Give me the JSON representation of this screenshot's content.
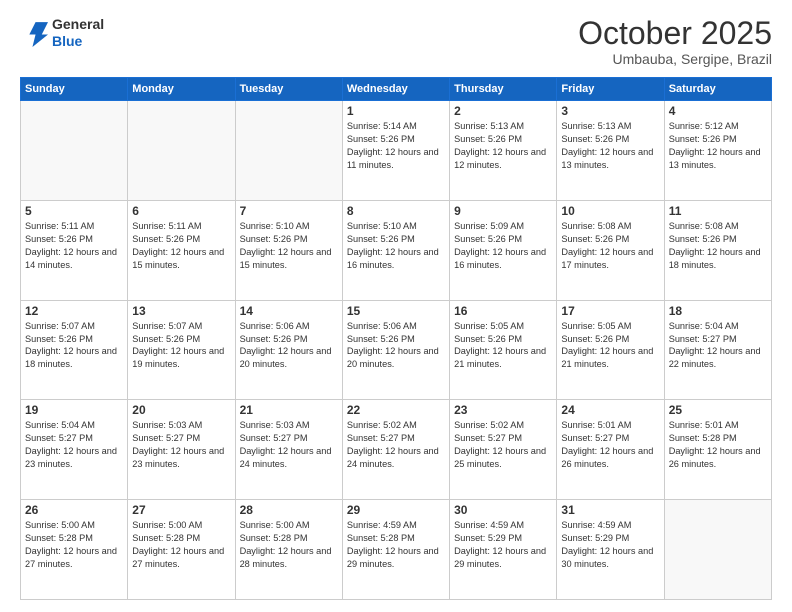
{
  "header": {
    "logo_line1": "General",
    "logo_line2": "Blue",
    "month_title": "October 2025",
    "location": "Umbauba, Sergipe, Brazil"
  },
  "weekdays": [
    "Sunday",
    "Monday",
    "Tuesday",
    "Wednesday",
    "Thursday",
    "Friday",
    "Saturday"
  ],
  "weeks": [
    [
      {
        "day": "",
        "text": ""
      },
      {
        "day": "",
        "text": ""
      },
      {
        "day": "",
        "text": ""
      },
      {
        "day": "1",
        "text": "Sunrise: 5:14 AM\nSunset: 5:26 PM\nDaylight: 12 hours\nand 11 minutes."
      },
      {
        "day": "2",
        "text": "Sunrise: 5:13 AM\nSunset: 5:26 PM\nDaylight: 12 hours\nand 12 minutes."
      },
      {
        "day": "3",
        "text": "Sunrise: 5:13 AM\nSunset: 5:26 PM\nDaylight: 12 hours\nand 13 minutes."
      },
      {
        "day": "4",
        "text": "Sunrise: 5:12 AM\nSunset: 5:26 PM\nDaylight: 12 hours\nand 13 minutes."
      }
    ],
    [
      {
        "day": "5",
        "text": "Sunrise: 5:11 AM\nSunset: 5:26 PM\nDaylight: 12 hours\nand 14 minutes."
      },
      {
        "day": "6",
        "text": "Sunrise: 5:11 AM\nSunset: 5:26 PM\nDaylight: 12 hours\nand 15 minutes."
      },
      {
        "day": "7",
        "text": "Sunrise: 5:10 AM\nSunset: 5:26 PM\nDaylight: 12 hours\nand 15 minutes."
      },
      {
        "day": "8",
        "text": "Sunrise: 5:10 AM\nSunset: 5:26 PM\nDaylight: 12 hours\nand 16 minutes."
      },
      {
        "day": "9",
        "text": "Sunrise: 5:09 AM\nSunset: 5:26 PM\nDaylight: 12 hours\nand 16 minutes."
      },
      {
        "day": "10",
        "text": "Sunrise: 5:08 AM\nSunset: 5:26 PM\nDaylight: 12 hours\nand 17 minutes."
      },
      {
        "day": "11",
        "text": "Sunrise: 5:08 AM\nSunset: 5:26 PM\nDaylight: 12 hours\nand 18 minutes."
      }
    ],
    [
      {
        "day": "12",
        "text": "Sunrise: 5:07 AM\nSunset: 5:26 PM\nDaylight: 12 hours\nand 18 minutes."
      },
      {
        "day": "13",
        "text": "Sunrise: 5:07 AM\nSunset: 5:26 PM\nDaylight: 12 hours\nand 19 minutes."
      },
      {
        "day": "14",
        "text": "Sunrise: 5:06 AM\nSunset: 5:26 PM\nDaylight: 12 hours\nand 20 minutes."
      },
      {
        "day": "15",
        "text": "Sunrise: 5:06 AM\nSunset: 5:26 PM\nDaylight: 12 hours\nand 20 minutes."
      },
      {
        "day": "16",
        "text": "Sunrise: 5:05 AM\nSunset: 5:26 PM\nDaylight: 12 hours\nand 21 minutes."
      },
      {
        "day": "17",
        "text": "Sunrise: 5:05 AM\nSunset: 5:26 PM\nDaylight: 12 hours\nand 21 minutes."
      },
      {
        "day": "18",
        "text": "Sunrise: 5:04 AM\nSunset: 5:27 PM\nDaylight: 12 hours\nand 22 minutes."
      }
    ],
    [
      {
        "day": "19",
        "text": "Sunrise: 5:04 AM\nSunset: 5:27 PM\nDaylight: 12 hours\nand 23 minutes."
      },
      {
        "day": "20",
        "text": "Sunrise: 5:03 AM\nSunset: 5:27 PM\nDaylight: 12 hours\nand 23 minutes."
      },
      {
        "day": "21",
        "text": "Sunrise: 5:03 AM\nSunset: 5:27 PM\nDaylight: 12 hours\nand 24 minutes."
      },
      {
        "day": "22",
        "text": "Sunrise: 5:02 AM\nSunset: 5:27 PM\nDaylight: 12 hours\nand 24 minutes."
      },
      {
        "day": "23",
        "text": "Sunrise: 5:02 AM\nSunset: 5:27 PM\nDaylight: 12 hours\nand 25 minutes."
      },
      {
        "day": "24",
        "text": "Sunrise: 5:01 AM\nSunset: 5:27 PM\nDaylight: 12 hours\nand 26 minutes."
      },
      {
        "day": "25",
        "text": "Sunrise: 5:01 AM\nSunset: 5:28 PM\nDaylight: 12 hours\nand 26 minutes."
      }
    ],
    [
      {
        "day": "26",
        "text": "Sunrise: 5:00 AM\nSunset: 5:28 PM\nDaylight: 12 hours\nand 27 minutes."
      },
      {
        "day": "27",
        "text": "Sunrise: 5:00 AM\nSunset: 5:28 PM\nDaylight: 12 hours\nand 27 minutes."
      },
      {
        "day": "28",
        "text": "Sunrise: 5:00 AM\nSunset: 5:28 PM\nDaylight: 12 hours\nand 28 minutes."
      },
      {
        "day": "29",
        "text": "Sunrise: 4:59 AM\nSunset: 5:28 PM\nDaylight: 12 hours\nand 29 minutes."
      },
      {
        "day": "30",
        "text": "Sunrise: 4:59 AM\nSunset: 5:29 PM\nDaylight: 12 hours\nand 29 minutes."
      },
      {
        "day": "31",
        "text": "Sunrise: 4:59 AM\nSunset: 5:29 PM\nDaylight: 12 hours\nand 30 minutes."
      },
      {
        "day": "",
        "text": ""
      }
    ]
  ]
}
